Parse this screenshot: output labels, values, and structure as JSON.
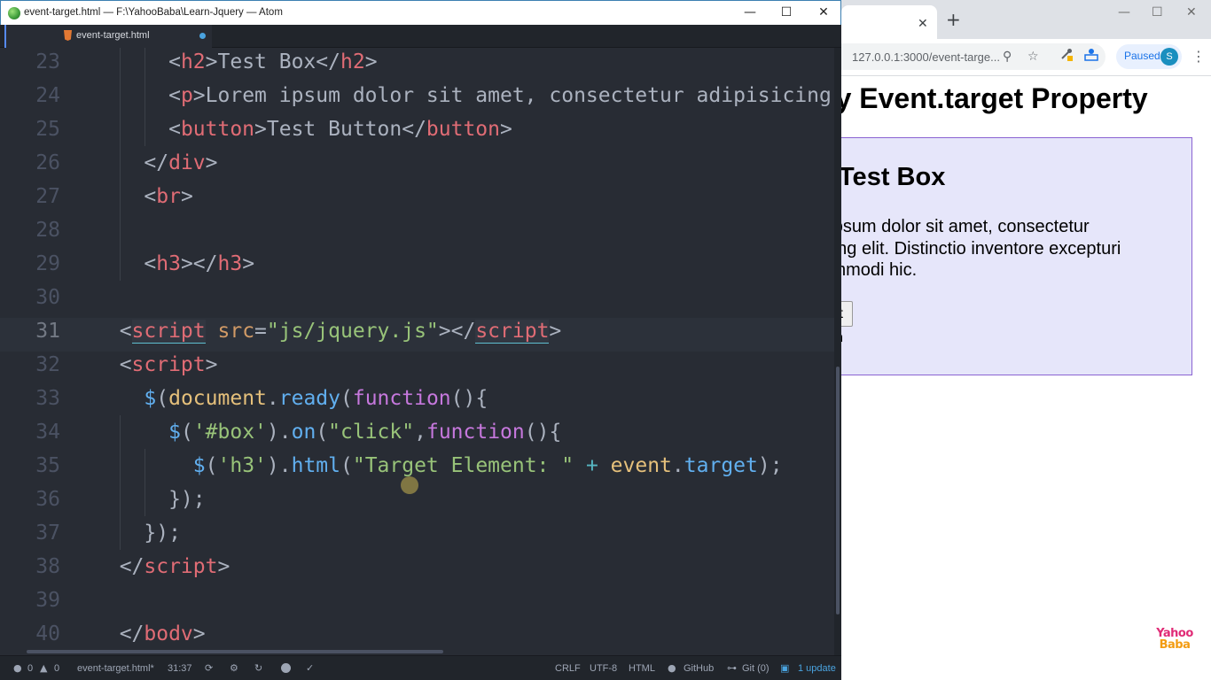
{
  "atom": {
    "window_title": "event-target.html — F:\\YahooBaba\\Learn-Jquery — Atom",
    "window_controls": {
      "minimize": "—",
      "maximize": "☐",
      "close": "✕"
    },
    "tab": {
      "label": "event-target.html",
      "modified": true
    },
    "editor": {
      "active_line": 31,
      "line_numbers": [
        "23",
        "24",
        "25",
        "26",
        "27",
        "28",
        "29",
        "30",
        "31",
        "32",
        "33",
        "34",
        "35",
        "36",
        "37",
        "38",
        "39",
        "40"
      ],
      "lines": [
        [
          [
            "punc",
            "      <"
          ],
          [
            "tag",
            "h2"
          ],
          [
            "punc",
            ">"
          ],
          [
            "text",
            "Test Box"
          ],
          [
            "punc",
            "</"
          ],
          [
            "tag",
            "h2"
          ],
          [
            "punc",
            ">"
          ]
        ],
        [
          [
            "punc",
            "      <"
          ],
          [
            "tag",
            "p"
          ],
          [
            "punc",
            ">"
          ],
          [
            "text",
            "Lorem ipsum dolor sit amet, consectetur adipisicing"
          ]
        ],
        [
          [
            "punc",
            "      <"
          ],
          [
            "tag",
            "button"
          ],
          [
            "punc",
            ">"
          ],
          [
            "text",
            "Test Button"
          ],
          [
            "punc",
            "</"
          ],
          [
            "tag",
            "button"
          ],
          [
            "punc",
            ">"
          ]
        ],
        [
          [
            "punc",
            "    </"
          ],
          [
            "tag",
            "div"
          ],
          [
            "punc",
            ">"
          ]
        ],
        [
          [
            "punc",
            "    <"
          ],
          [
            "tag",
            "br"
          ],
          [
            "punc",
            ">"
          ]
        ],
        [],
        [
          [
            "punc",
            "    <"
          ],
          [
            "tag",
            "h3"
          ],
          [
            "punc",
            "></"
          ],
          [
            "tag",
            "h3"
          ],
          [
            "punc",
            ">"
          ]
        ],
        [],
        [
          [
            "punc",
            "  <"
          ],
          [
            "tag",
            "script"
          ],
          [
            "text",
            " "
          ],
          [
            "attr",
            "src"
          ],
          [
            "punc",
            "="
          ],
          [
            "str",
            "\"js/jquery.js\""
          ],
          [
            "punc",
            "></"
          ],
          [
            "tag",
            "script"
          ],
          [
            "punc",
            ">"
          ]
        ],
        [
          [
            "punc",
            "  <"
          ],
          [
            "tag",
            "script"
          ],
          [
            "punc",
            ">"
          ]
        ],
        [
          [
            "text",
            "    "
          ],
          [
            "fn",
            "$"
          ],
          [
            "punc",
            "("
          ],
          [
            "doc",
            "document"
          ],
          [
            "punc",
            "."
          ],
          [
            "fn",
            "ready"
          ],
          [
            "punc",
            "("
          ],
          [
            "kw",
            "function"
          ],
          [
            "punc",
            "(){"
          ]
        ],
        [
          [
            "text",
            "      "
          ],
          [
            "fn",
            "$"
          ],
          [
            "punc",
            "("
          ],
          [
            "str",
            "'#box'"
          ],
          [
            "punc",
            ")."
          ],
          [
            "fn",
            "on"
          ],
          [
            "punc",
            "("
          ],
          [
            "str",
            "\"click\""
          ],
          [
            "punc",
            ","
          ],
          [
            "kw",
            "function"
          ],
          [
            "punc",
            "(){"
          ]
        ],
        [
          [
            "text",
            "        "
          ],
          [
            "fn",
            "$"
          ],
          [
            "punc",
            "("
          ],
          [
            "str",
            "'h3'"
          ],
          [
            "punc",
            ")."
          ],
          [
            "fn",
            "html"
          ],
          [
            "punc",
            "("
          ],
          [
            "str",
            "\"Target Element: \""
          ],
          [
            "text",
            " "
          ],
          [
            "op",
            "+"
          ],
          [
            "text",
            " "
          ],
          [
            "doc",
            "event"
          ],
          [
            "punc",
            "."
          ],
          [
            "fn",
            "target"
          ],
          [
            "punc",
            ");"
          ]
        ],
        [
          [
            "punc",
            "      });"
          ]
        ],
        [
          [
            "punc",
            "    });"
          ]
        ],
        [
          [
            "punc",
            "  </"
          ],
          [
            "tag",
            "script"
          ],
          [
            "punc",
            ">"
          ]
        ],
        [],
        [
          [
            "punc",
            "  </"
          ],
          [
            "tag",
            "bodv"
          ],
          [
            "punc",
            ">"
          ]
        ]
      ]
    },
    "status_bar": {
      "errors": "0",
      "warnings": "0",
      "file": "event-target.html*",
      "cursor": "31:37",
      "line_ending": "CRLF",
      "encoding": "UTF-8",
      "grammar": "HTML",
      "github": "GitHub",
      "git": "Git (0)",
      "update": "1 update"
    }
  },
  "browser": {
    "tab_close": "✕",
    "new_tab": "+",
    "window_controls": {
      "minimize": "—",
      "maximize": "☐",
      "close": "✕"
    },
    "url": "127.0.0.1:3000/event-targe...",
    "profile": {
      "label": "Paused",
      "initial": "S"
    },
    "page": {
      "heading": "jQuery Event.target Property",
      "box_title": "Test Box",
      "box_text": "Lorem ipsum dolor sit amet, consectetur adipisicing elit. Distinctio inventore excepturi cum commodi hic.",
      "box_button": "Test Button"
    },
    "logo": {
      "line1": "Yahoo",
      "line2": "Baba"
    }
  },
  "colors": {
    "editor_bg": "#282c34",
    "chrome_bg": "#21252b",
    "tag": "#e06c75",
    "string": "#98c379",
    "function": "#61afef",
    "keyword": "#c678dd",
    "accent": "#4aa3df",
    "box_bg": "#e6e6fa"
  }
}
